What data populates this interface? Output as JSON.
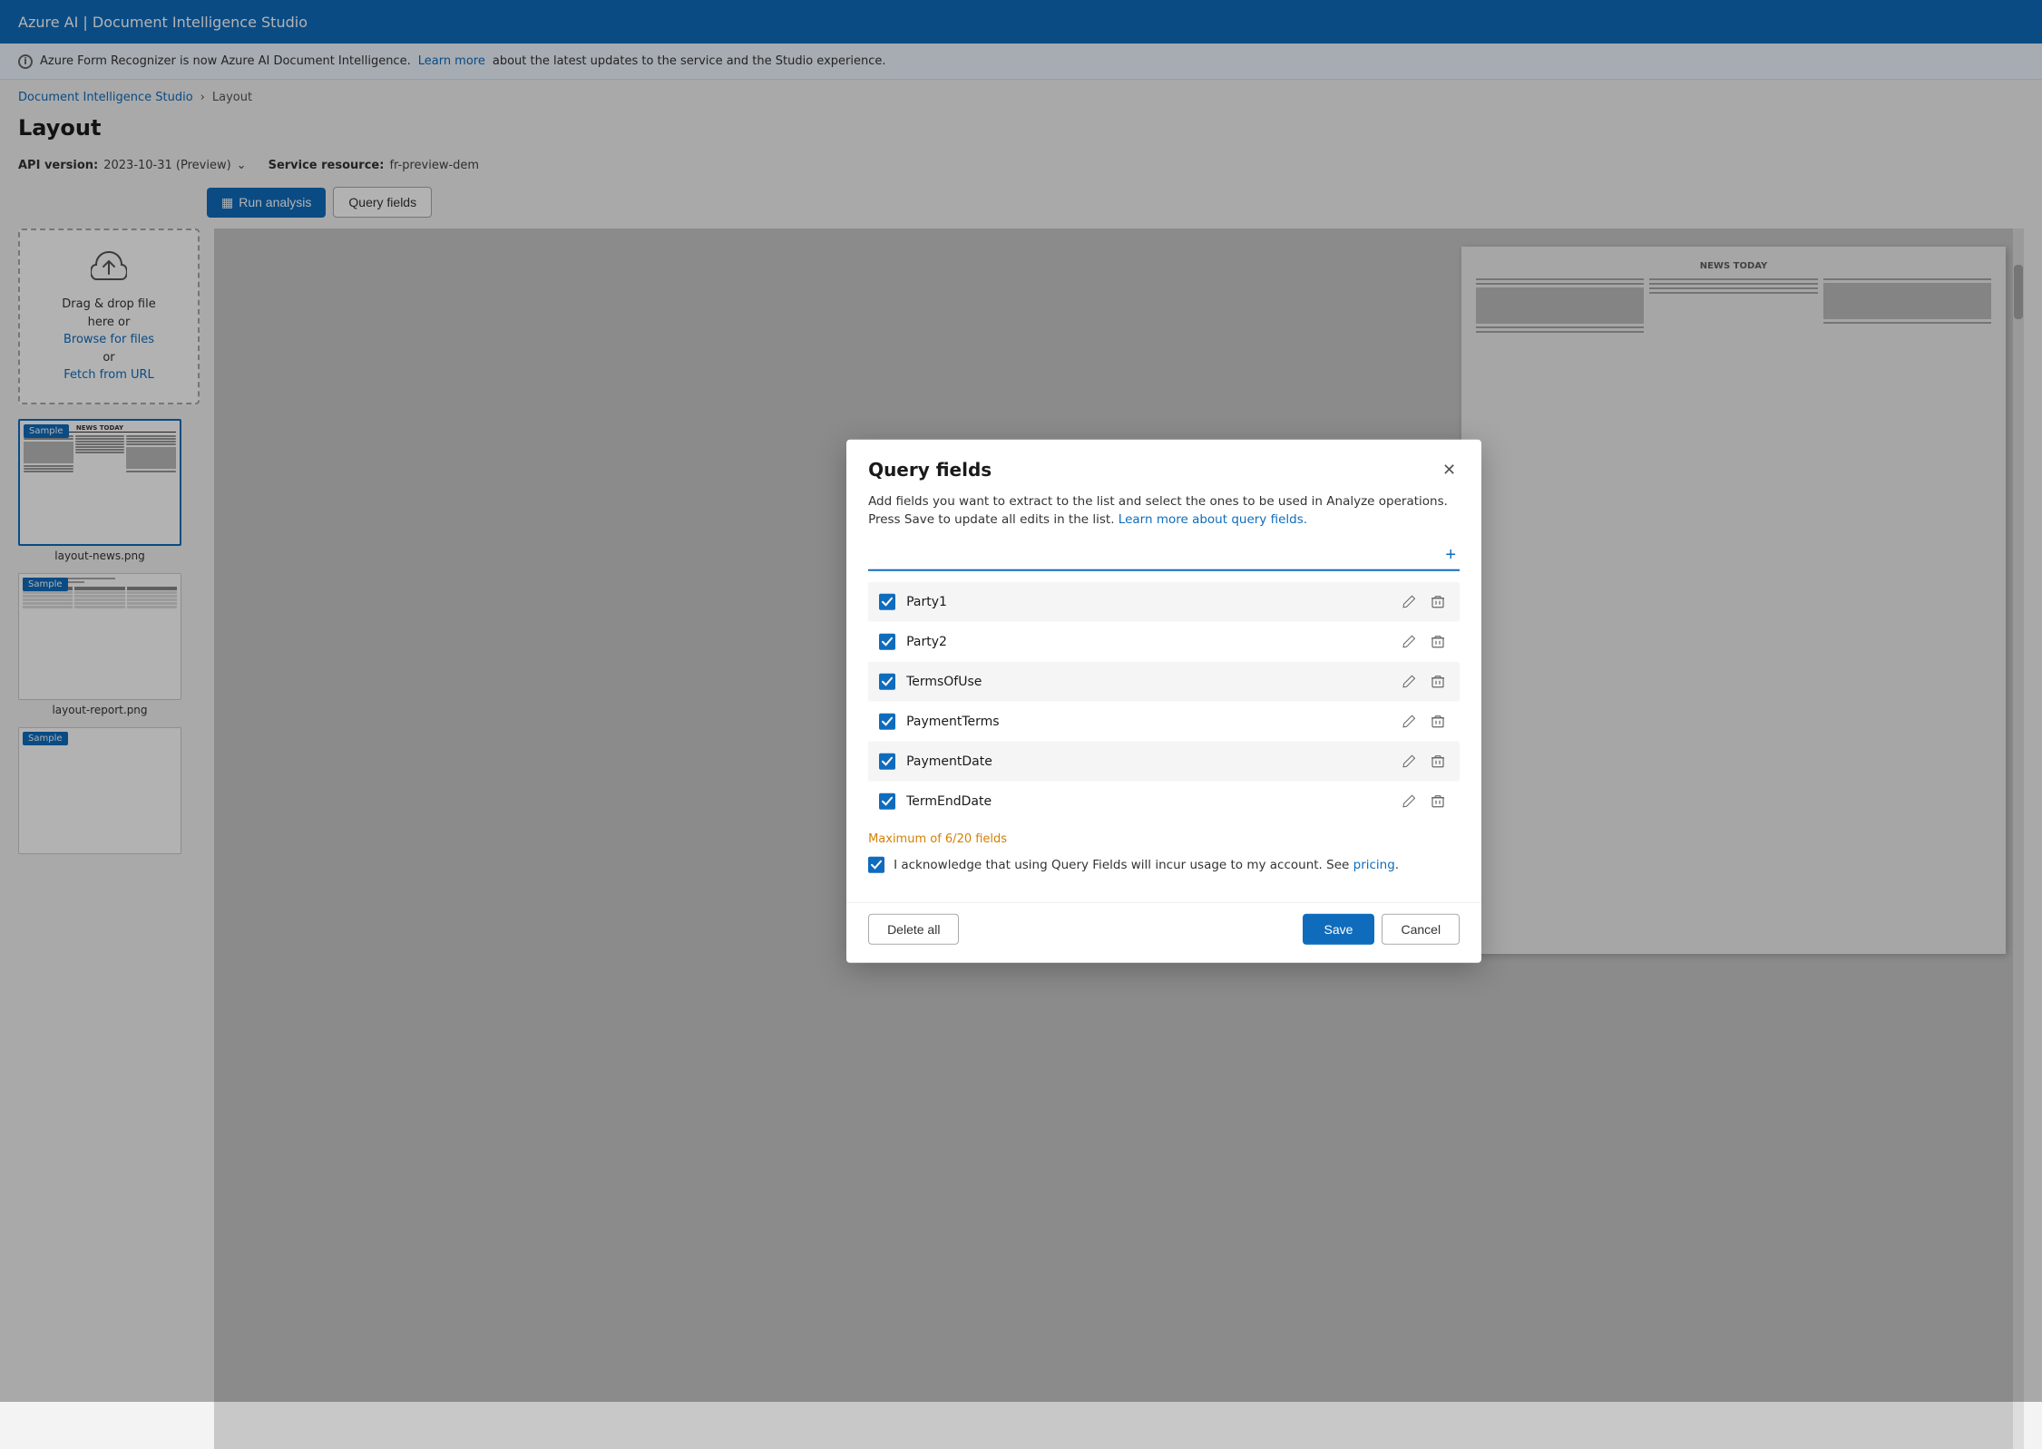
{
  "app": {
    "title": "Azure AI | Document Intelligence Studio"
  },
  "banner": {
    "text": "Azure Form Recognizer is now Azure AI Document Intelligence.",
    "link_text": "Learn more",
    "rest": "about the latest updates to the service and the Studio experience."
  },
  "breadcrumb": {
    "home": "Document Intelligence Studio",
    "current": "Layout"
  },
  "page_title": "Layout",
  "api_bar": {
    "api_label": "API version:",
    "api_value": "2023-10-31 (Preview)",
    "service_label": "Service resource:",
    "service_value": "fr-preview-dem"
  },
  "toolbar": {
    "run_analysis": "Run analysis",
    "query_fields": "Query fields"
  },
  "upload_zone": {
    "text1": "Drag & drop file",
    "text2": "here or",
    "browse_link": "Browse for files",
    "text3": "or",
    "fetch_link": "Fetch from URL"
  },
  "thumbnails": [
    {
      "label": "layout-news.png",
      "sample": "Sample",
      "active": true
    },
    {
      "label": "layout-report.png",
      "sample": "Sample",
      "active": false
    },
    {
      "label": "",
      "sample": "Sample",
      "active": false
    }
  ],
  "modal": {
    "title": "Query fields",
    "description": "Add fields you want to extract to the list and select the ones to be used in Analyze operations. Press Save to update all edits in the list.",
    "learn_more_link": "Learn more about query fields.",
    "add_placeholder": "",
    "fields": [
      {
        "name": "Party1",
        "checked": true
      },
      {
        "name": "Party2",
        "checked": true
      },
      {
        "name": "TermsOfUse",
        "checked": true
      },
      {
        "name": "PaymentTerms",
        "checked": true
      },
      {
        "name": "PaymentDate",
        "checked": true
      },
      {
        "name": "TermEndDate",
        "checked": true
      }
    ],
    "max_fields_note": "Maximum of 6/20 fields",
    "acknowledge_text": "I acknowledge that using Query Fields will incur usage to my account. See",
    "acknowledge_link": "pricing",
    "acknowledge_dot": ".",
    "delete_all_label": "Delete all",
    "save_label": "Save",
    "cancel_label": "Cancel",
    "close_label": "✕"
  },
  "icons": {
    "run_analysis": "▦",
    "plus": "+",
    "edit": "✏",
    "delete": "🗑",
    "checkmark": "✓",
    "chevron_down": "⌄",
    "chevron_right": "›",
    "info": "i"
  }
}
